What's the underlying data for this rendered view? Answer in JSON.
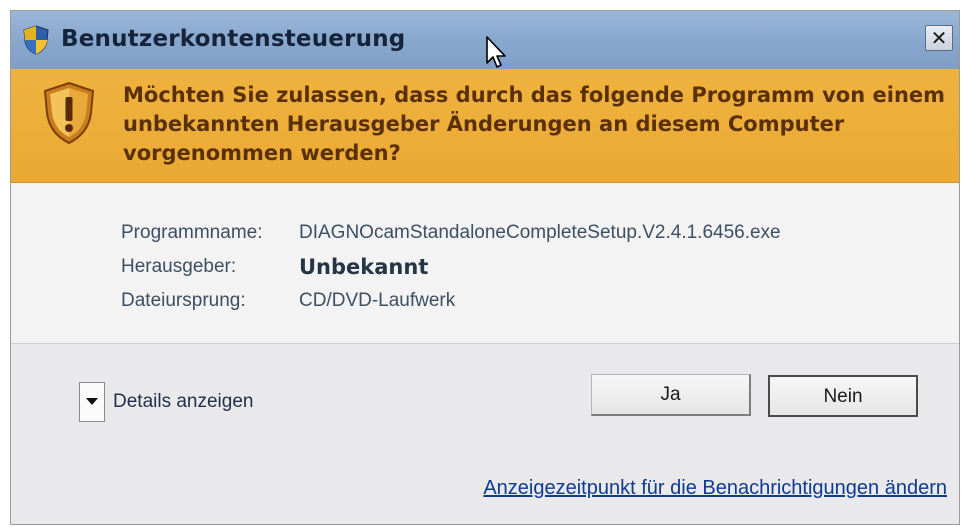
{
  "window": {
    "title": "Benutzerkontensteuerung",
    "close_glyph": "✕"
  },
  "banner": {
    "message": "Möchten Sie zulassen, dass durch das folgende Programm von einem unbekannten Herausgeber Änderungen an diesem Computer vorgenommen werden?",
    "icon": "uac-warning-shield-icon"
  },
  "details": {
    "program_label": "Programmname:",
    "program_value": "DIAGNOcamStandaloneCompleteSetup.V2.4.1.6456.exe",
    "publisher_label": "Herausgeber:",
    "publisher_value": "Unbekannt",
    "origin_label": "Dateiursprung:",
    "origin_value": "CD/DVD-Laufwerk"
  },
  "footer": {
    "details_toggle": "Details anzeigen",
    "yes_button": "Ja",
    "no_button": "Nein",
    "settings_link": "Anzeigezeitpunkt für die Benachrichtigungen ändern"
  },
  "colors": {
    "titlebar": "#8aa9cf",
    "banner": "#eeae3a",
    "banner_text": "#5a3008",
    "link": "#0f3b8f"
  }
}
